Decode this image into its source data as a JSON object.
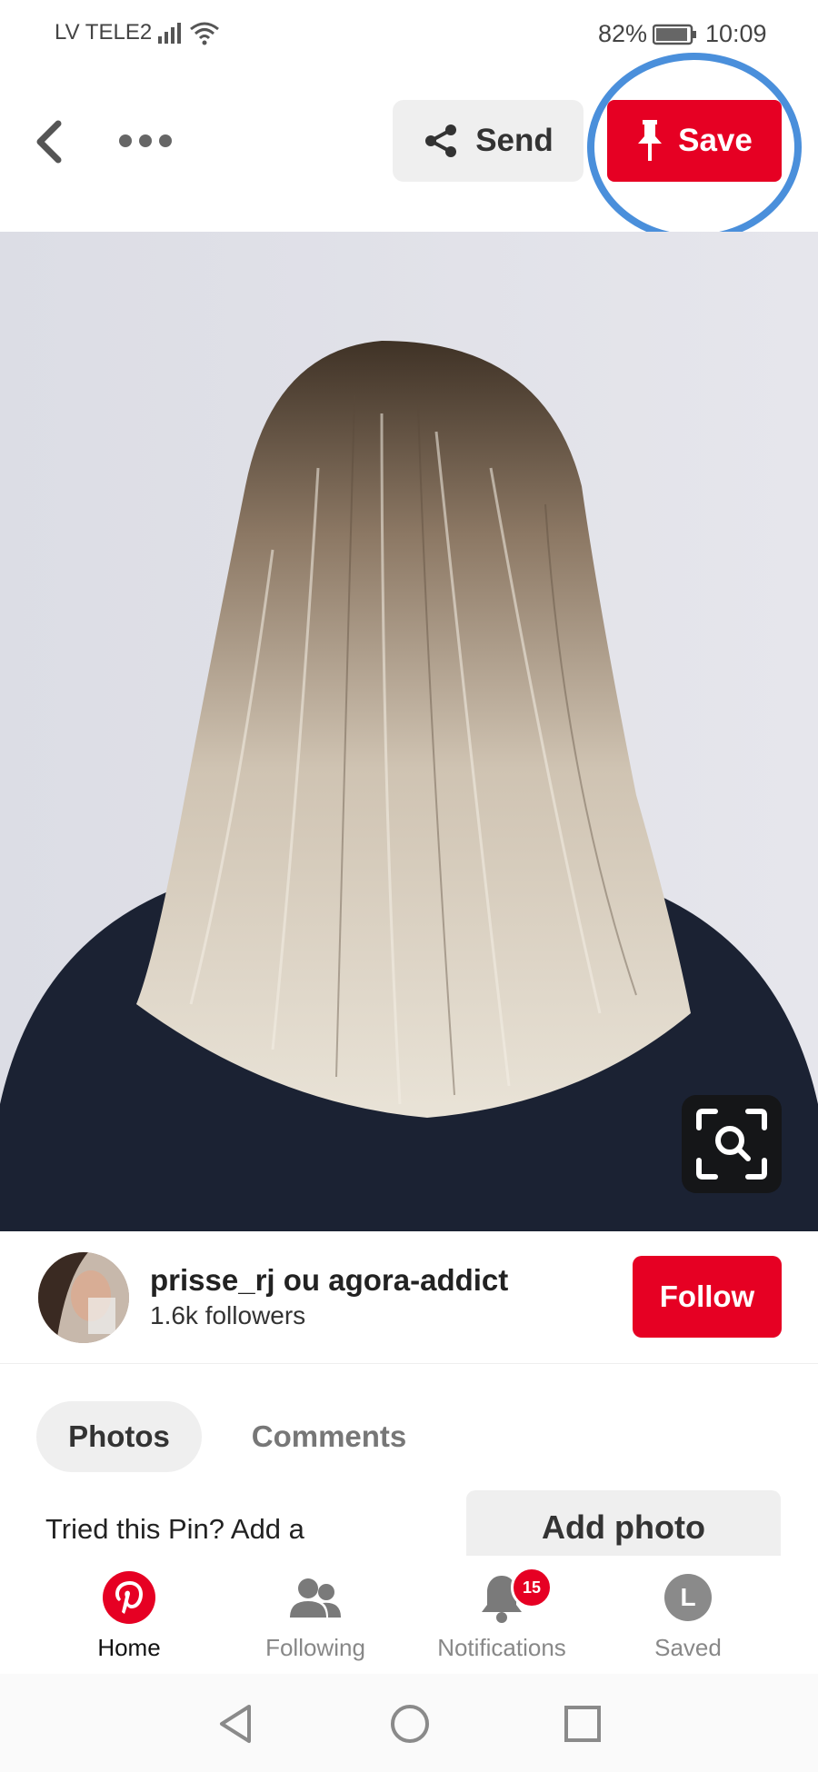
{
  "status_bar": {
    "carrier": "LV TELE2",
    "battery_percent": "82%",
    "time": "10:09"
  },
  "top_bar": {
    "send_label": "Send",
    "save_label": "Save"
  },
  "creator": {
    "name": "prisse_rj ou agora-addict",
    "followers": "1.6k followers",
    "follow_label": "Follow"
  },
  "tabs": {
    "photos": "Photos",
    "comments": "Comments"
  },
  "tried_section": {
    "prompt": "Tried this Pin? Add a",
    "add_photo_label": "Add photo"
  },
  "bottom_nav": {
    "items": [
      {
        "label": "Home",
        "icon": "pinterest-logo-icon",
        "active": true
      },
      {
        "label": "Following",
        "icon": "people-icon"
      },
      {
        "label": "Notifications",
        "icon": "bell-icon",
        "badge": "15"
      },
      {
        "label": "Saved",
        "icon": "avatar-icon",
        "avatar_letter": "L"
      }
    ]
  },
  "colors": {
    "brand_red": "#e60023",
    "highlight_ring": "#4a8fdb"
  }
}
